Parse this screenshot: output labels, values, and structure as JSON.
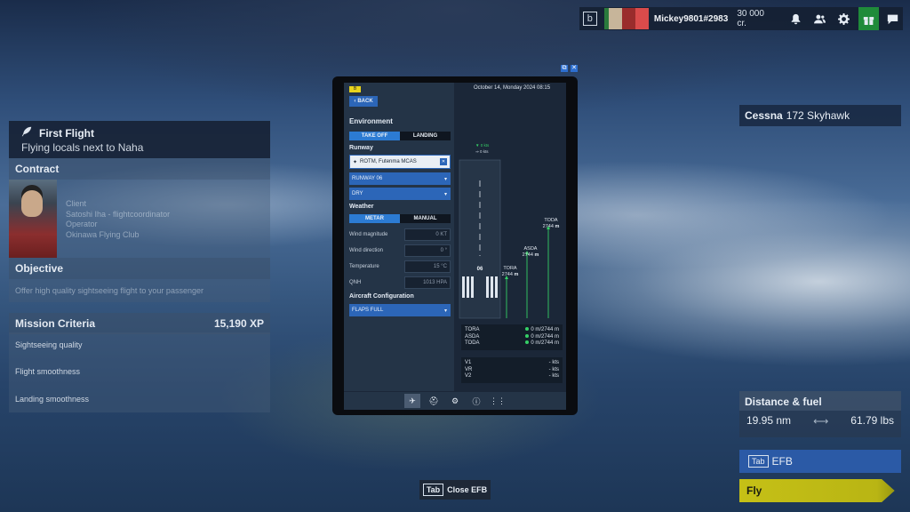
{
  "topbar": {
    "b_label": "b",
    "username": "Mickey9801#2983",
    "credits": "30 000 cr.",
    "icons": [
      "bell-icon",
      "friends-icon",
      "gear-icon",
      "gift-icon",
      "chat-icon"
    ]
  },
  "aircraft": {
    "make": "Cessna",
    "model": "172 Skyhawk"
  },
  "mission": {
    "title": "First Flight",
    "subtitle": "Flying locals next to Naha",
    "contract_title": "Contract",
    "client_label": "Client",
    "client_name": "Satoshi Iha - flightcoordinator",
    "operator_label": "Operator",
    "operator_name": "Okinawa Flying Club",
    "objective_title": "Objective",
    "objective_text": "Offer high quality sightseeing flight to your passenger",
    "criteria_title": "Mission Criteria",
    "xp": "15,190 XP",
    "criteria": [
      "Sightseeing quality",
      "Flight smoothness",
      "Landing smoothness"
    ]
  },
  "distance_fuel": {
    "title": "Distance & fuel",
    "distance": "19.95 nm",
    "fuel": "61.79 lbs"
  },
  "efb_button": {
    "key": "Tab",
    "label": "EFB"
  },
  "fly_button": {
    "label": "Fly"
  },
  "close_efb": {
    "key": "Tab",
    "label": "Close EFB"
  },
  "efb": {
    "badge": "B",
    "back": "BACK",
    "date": "October 14, Monday 2024 08:15",
    "environment": "Environment",
    "takeoff": "TAKE OFF",
    "landing": "LANDING",
    "runway_label": "Runway",
    "airport": "ROTM, Futenma MCAS",
    "runway": "RUNWAY 06",
    "surface": "DRY",
    "weather_label": "Weather",
    "metar": "METAR",
    "manual": "MANUAL",
    "wind_magnitude_label": "Wind magnitude",
    "wind_magnitude": "0 KT",
    "wind_direction_label": "Wind direction",
    "wind_direction": "0 °",
    "temperature_label": "Temperature",
    "temperature": "15 °C",
    "qnh_label": "QNH",
    "qnh": "1013 HPA",
    "aircraft_config_label": "Aircraft Configuration",
    "flaps": "FLAPS FULL",
    "runway_number": "06",
    "wind_top": "0 kts",
    "wind_side": "0 kts",
    "tora_label": "TORA",
    "tora_value": "2744",
    "asda_label": "ASDA",
    "asda_value": "2744",
    "toda_label": "TODA",
    "toda_value": "2744",
    "unit_m": "m",
    "summary": [
      {
        "label": "TORA",
        "value": "0 m/2744 m"
      },
      {
        "label": "ASDA",
        "value": "0 m/2744 m"
      },
      {
        "label": "TODA",
        "value": "0 m/2744 m"
      }
    ],
    "speeds": [
      {
        "label": "V1",
        "value": "- kts"
      },
      {
        "label": "VR",
        "value": "- kts"
      },
      {
        "label": "V2",
        "value": "- kts"
      }
    ]
  },
  "colors": {
    "accent": "#2c7bd3",
    "fly": "#c5c016",
    "green": "#1f8b3a",
    "efb_blue": "#2b5aa6"
  }
}
